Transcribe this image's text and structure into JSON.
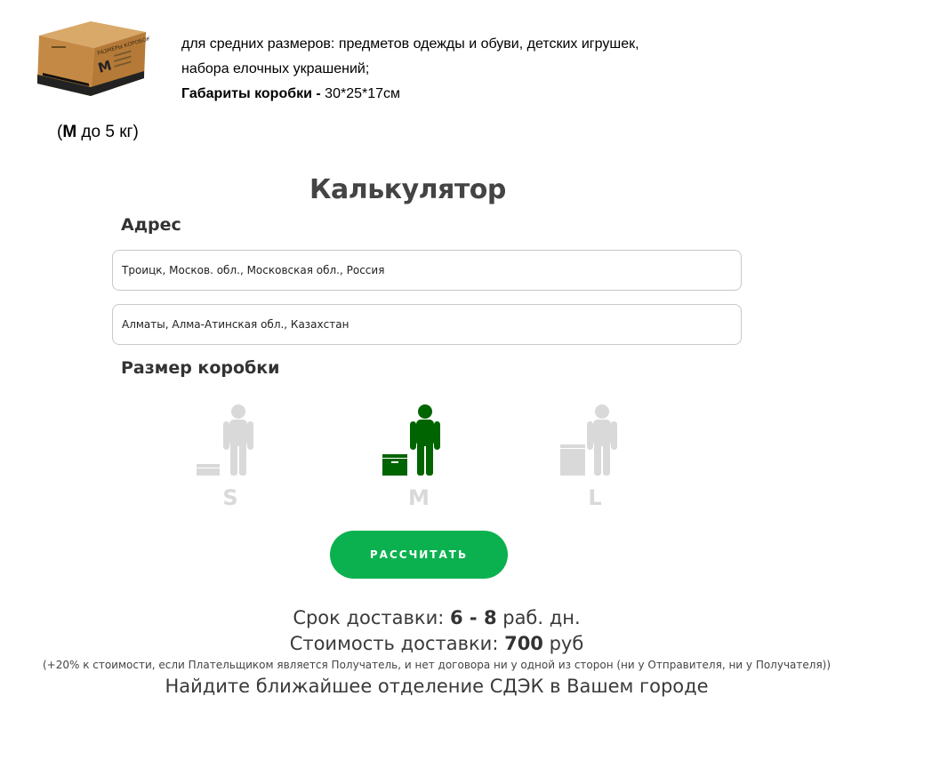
{
  "product": {
    "box_text_main": "РАЗМЕРЫ КОРОБОК",
    "box_letter": "M",
    "description_line1": "для средних размеров: предметов одежды и обуви, детских игрушек,",
    "description_line2": "набора елочных украшений;",
    "dims_label": "Габариты коробки -",
    "dims_value": " 30*25*17см",
    "weight_open": "(",
    "weight_size": "M",
    "weight_text": " до 5 кг)"
  },
  "calculator": {
    "title": "Калькулятор",
    "address_label": "Адрес",
    "from_value": "Троицк, Москов. обл., Московская обл., Россия",
    "to_value": "Алматы, Алма-Атинская обл., Казахстан",
    "size_label": "Размер коробки",
    "sizes": [
      {
        "label": "S",
        "color": "#d9d9d9"
      },
      {
        "label": "M",
        "color": "#006400"
      },
      {
        "label": "L",
        "color": "#d9d9d9"
      }
    ],
    "selected_size": "M",
    "button_label": "РАССЧИТАТЬ",
    "button_color": "#0bb14f"
  },
  "result": {
    "time_prefix": "Срок доставки: ",
    "time_value": "6 - 8",
    "time_suffix": " раб. дн.",
    "cost_prefix": "Стоимость доставки: ",
    "cost_value": "700",
    "cost_suffix": " руб",
    "note": "(+20% к стоимости, если Плательщиком является Получатель, и нет договора ни у одной из сторон (ни у Отправителя, ни у Получателя))",
    "office_link": "Найдите ближайшее отделение СДЭК в Вашем городе"
  }
}
